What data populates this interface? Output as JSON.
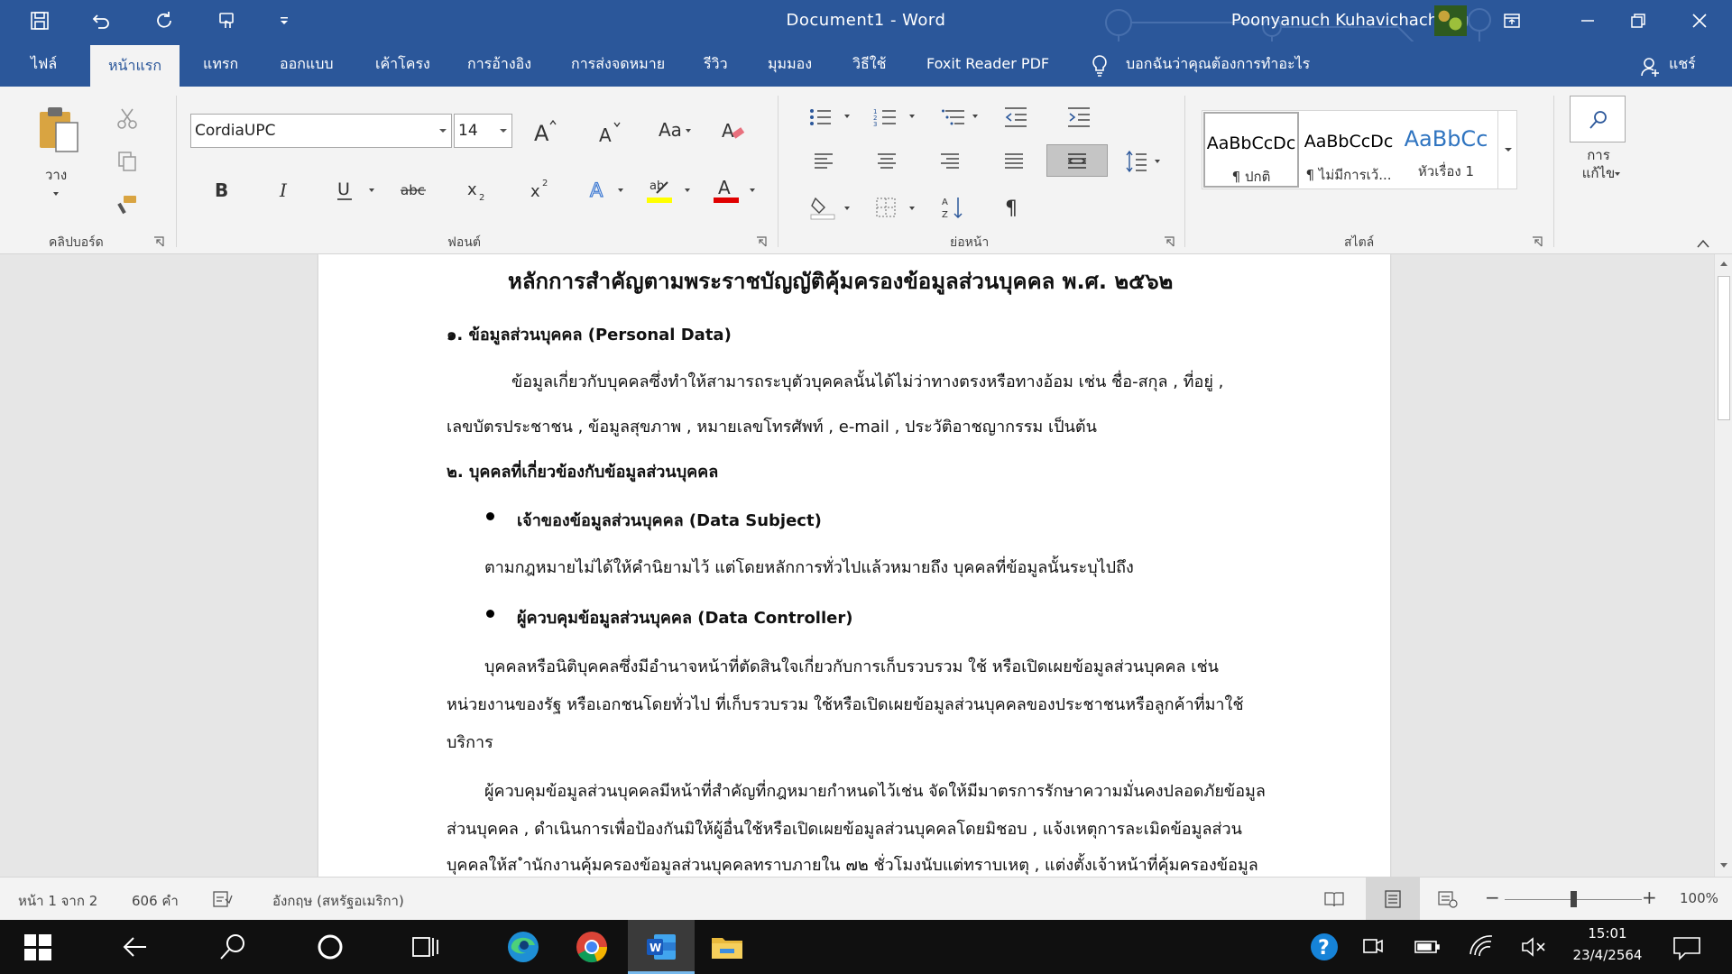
{
  "window": {
    "title": "Document1  -  Word",
    "user_name": "Poonyanuch Kuhavichachang"
  },
  "tabs": [
    "ไฟล์",
    "หน้าแรก",
    "แทรก",
    "ออกแบบ",
    "เค้าโครง",
    "การอ้างอิง",
    "การส่งจดหมาย",
    "รีวิว",
    "มุมมอง",
    "วิธีใช้",
    "Foxit Reader PDF"
  ],
  "active_tab": "หน้าแรก",
  "tell_me": "บอกฉันว่าคุณต้องการทำอะไร",
  "share": "แชร์",
  "ribbon": {
    "clipboard": {
      "paste_label": "วาง",
      "group_label": "คลิปบอร์ด"
    },
    "font": {
      "font_name": "CordiaUPC",
      "font_size": "14",
      "change_case": "Aa",
      "group_label": "ฟอนต์"
    },
    "paragraph": {
      "group_label": "ย่อหน้า"
    },
    "styles": {
      "group_label": "สไตล์",
      "items": [
        {
          "sample": "AaBbCcDc",
          "name": "¶ ปกติ"
        },
        {
          "sample": "AaBbCcDc",
          "name": "¶ ไม่มีการเว้..."
        },
        {
          "sample": "AaBbCc",
          "name": "หัวเรื่อง 1"
        }
      ]
    },
    "editing": {
      "label": "การ\nแก้ไข"
    }
  },
  "document": {
    "title": "หลักการสำคัญตามพระราชบัญญัติคุ้มครองข้อมูลส่วนบุคคล พ.ศ. ๒๕๖๒",
    "h1": "๑. ข้อมูลส่วนบุคคล (Personal Data)",
    "p1a": "ข้อมูลเกี่ยวกับบุคคลซึ่งทำให้สามารถระบุตัวบุคคลนั้นได้ไม่ว่าทางตรงหรือทางอ้อม เช่น ชื่อ-สกุล , ที่อยู่ ,",
    "p1b": "เลขบัตรประชาชน , ข้อมูลสุขภาพ , หมายเลขโทรศัพท์ , e-mail , ประวัติอาชญากรรม เป็นต้น",
    "h2": "๒. บุคคลที่เกี่ยวข้องกับข้อมูลส่วนบุคคล",
    "b1": "เจ้าของข้อมูลส่วนบุคคล (Data Subject)",
    "p2": "ตามกฎหมายไม่ได้ให้คำนิยามไว้ แต่โดยหลักการทั่วไปแล้วหมายถึง บุคคลที่ข้อมูลนั้นระบุไปถึง",
    "b2": "ผู้ควบคุมข้อมูลส่วนบุคคล (Data Controller)",
    "p3a": "บุคคลหรือนิติบุคคลซึ่งมีอำนาจหน้าที่ตัดสินใจเกี่ยวกับการเก็บรวบรวม ใช้ หรือเปิดเผยข้อมูลส่วนบุคคล เช่น",
    "p3b": "หน่วยงานของรัฐ หรือเอกชนโดยทั่วไป ที่เก็บรวบรวม ใช้หรือเปิดเผยข้อมูลส่วนบุคคลของประชาชนหรือลูกค้าที่มาใช้",
    "p3c": "บริการ",
    "p4a": "ผู้ควบคุมข้อมูลส่วนบุคคลมีหน้าที่สำคัญที่กฎหมายกำหนดไว้เช่น จัดให้มีมาตรการรักษาความมั่นคงปลอดภัยข้อมูล",
    "p4b": "ส่วนบุคคล , ดำเนินการเพื่อป้องกันมิให้ผู้อื่นใช้หรือเปิดเผยข้อมูลส่วนบุคคลโดยมิชอบ , แจ้งเหตุการละเมิดข้อมูลส่วน",
    "p4c": "บุคคลให้ส ำนักงานคุ้มครองข้อมูลส่วนบุคคลทราบภายใน ๗๒ ชั่วโมงนับแต่ทราบเหตุ , แต่งตั้งเจ้าหน้าที่คุ้มครองข้อมูล"
  },
  "statusbar": {
    "page": "หน้า 1 จาก 2",
    "words": "606 คำ",
    "language": "อังกฤษ (สหรัฐอเมริกา)",
    "zoom": "100%",
    "zoom_level": 1.0
  },
  "taskbar": {
    "time": "15:01",
    "date": "23/4/2564"
  },
  "colors": {
    "word_blue": "#2b579a",
    "ribbon_bg": "#f3f3f3",
    "highlight_yellow": "#ffff00",
    "font_red": "#e00000"
  }
}
